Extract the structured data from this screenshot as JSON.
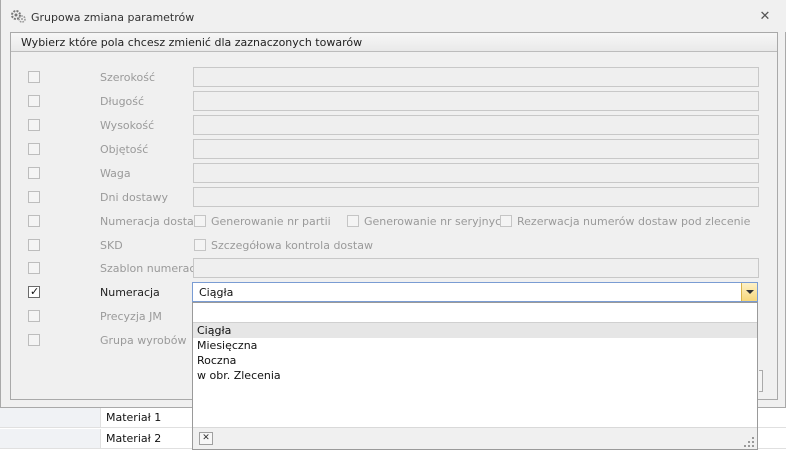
{
  "window": {
    "title": "Grupowa zmiana parametrów",
    "close_icon": "close-icon",
    "app_icon": "gears-icon"
  },
  "group": {
    "header": "Wybierz które pola chcesz zmienić dla zaznaczonych towarów"
  },
  "rows": [
    {
      "label": "Szerokość",
      "checked": false
    },
    {
      "label": "Długość",
      "checked": false
    },
    {
      "label": "Wysokość",
      "checked": false
    },
    {
      "label": "Objętość",
      "checked": false
    },
    {
      "label": "Waga",
      "checked": false
    },
    {
      "label": "Dni dostawy",
      "checked": false
    },
    {
      "label": "Numeracja dostaw",
      "checked": false
    },
    {
      "label": "SKD",
      "checked": false
    },
    {
      "label": "Szablon numeracji",
      "checked": false
    },
    {
      "label": "Numeracja",
      "checked": true
    },
    {
      "label": "Precyzja JM",
      "checked": false
    },
    {
      "label": "Grupa wyrobów",
      "checked": false
    }
  ],
  "numeracja_dostaw_options": [
    "Generowanie nr partii",
    "Generowanie nr seryjnych",
    "Rezerwacja numerów dostaw pod zlecenie"
  ],
  "skd_option": "Szczegółowa kontrola dostaw",
  "numeracja_combo": {
    "value": "Ciągła",
    "options": [
      "Ciągła",
      "Miesięczna",
      "Roczna",
      "w obr. Zlecenia"
    ],
    "selected_index": 0
  },
  "background_grid": {
    "rows": [
      "Materiał 1",
      "Materiał 2"
    ]
  },
  "colors": {
    "accent_combo_border": "#7a9cd3",
    "dropdown_button": "#f7d77a"
  }
}
